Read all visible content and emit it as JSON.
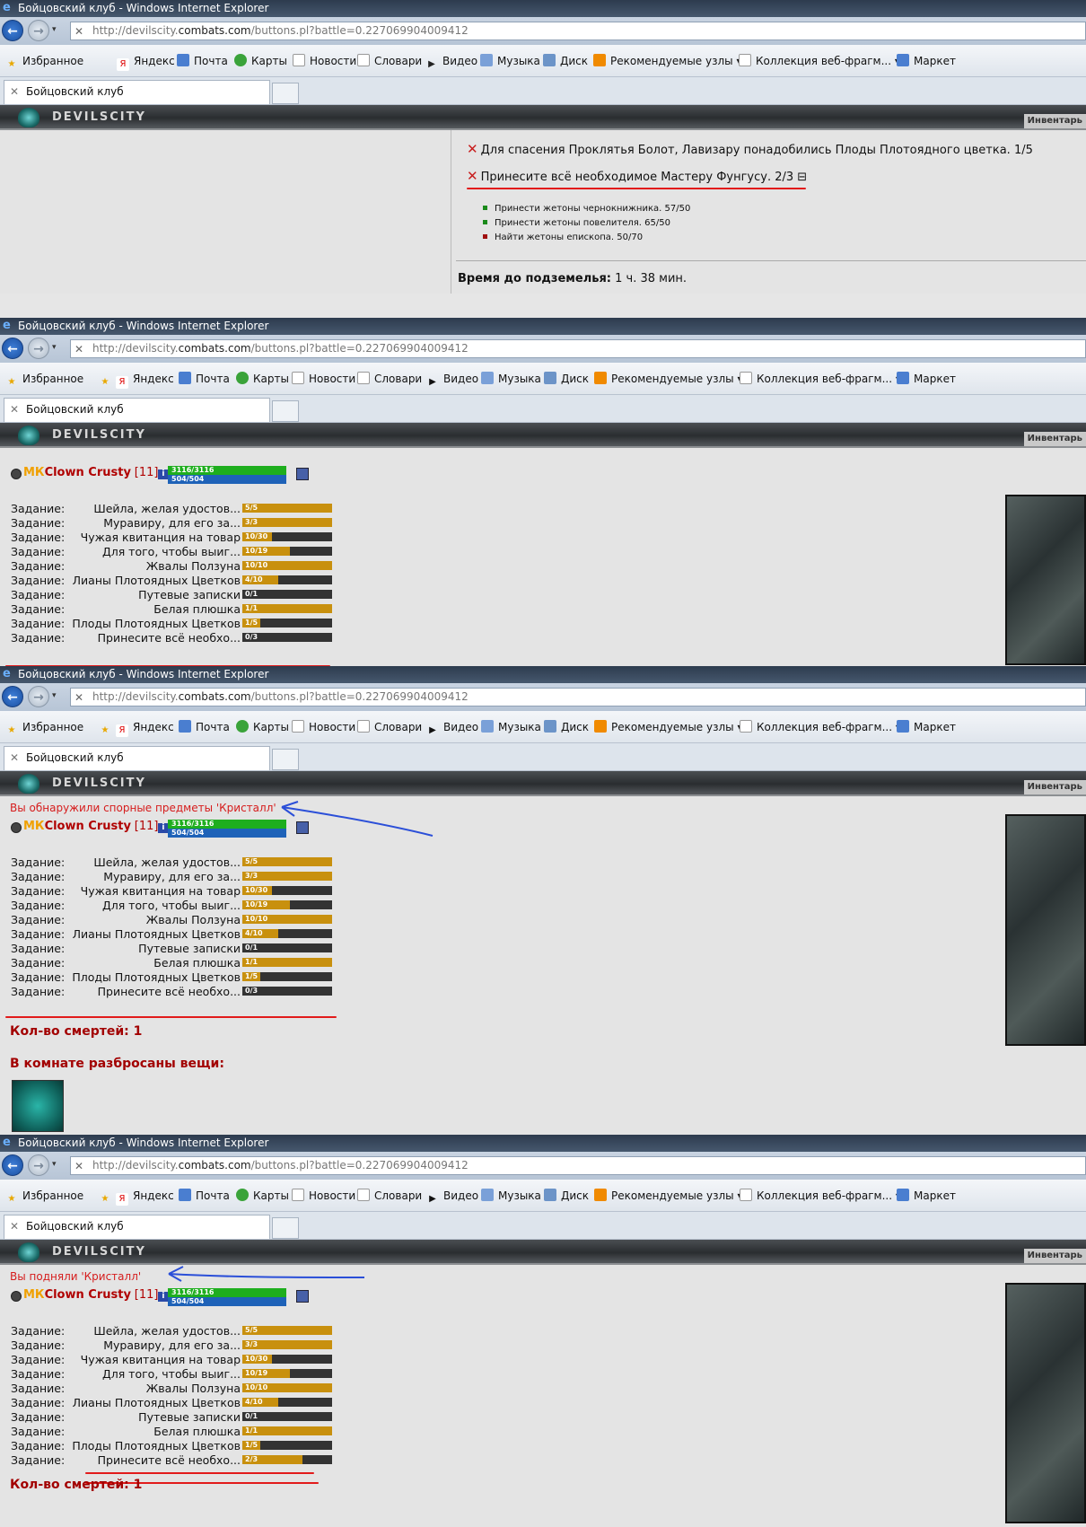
{
  "window_title": "Бойцовский клуб - Windows Internet Explorer",
  "url_prefix": "http://devilscity.",
  "url_host": "combats.com",
  "url_path": "/buttons.pl?battle=0.227069904009412",
  "favorites": {
    "fav": "Избранное",
    "yandex": "Яндекс",
    "mail": "Почта",
    "maps": "Карты",
    "news": "Новости",
    "dict": "Словари",
    "video": "Видео",
    "music": "Музыка",
    "disk": "Диск",
    "recommended": "Рекомендуемые узлы ▾",
    "webslices": "Коллекция веб-фрагм... ▾",
    "market": "Маркет"
  },
  "tab_label": "Бойцовский клуб",
  "game_logo": "DEVILSCITY",
  "inventory_label": "Инвентарь",
  "quest_log": {
    "item1": "Для спасения Проклятья Болот, Лавизару понадобились Плоды Плотоядного цветка. 1/5",
    "item2": "Принесите всё необходимое Мастеру Фунгусу. 2/3 ⊟",
    "sub": [
      {
        "text": "Принести жетоны чернокнижника. 57/50",
        "color": "#1a8a1a"
      },
      {
        "text": "Принести жетоны повелителя. 65/50",
        "color": "#1a8a1a"
      },
      {
        "text": "Найти жетоны епископа. 50/70",
        "color": "#a01010"
      }
    ],
    "timer_label": "Время до подземелья:",
    "timer_value": "1 ч. 38 мин."
  },
  "character": {
    "mk": "МК",
    "name": "Clown Crusty",
    "level": "[11]",
    "info": "i",
    "hp": "3116/3116",
    "mana": "504/504"
  },
  "task_label": "Задание:",
  "tasks": [
    {
      "text": "Шейла, желая удостов...",
      "value": "5/5",
      "fill": 1.0
    },
    {
      "text": "Муравиру, для его за...",
      "value": "3/3",
      "fill": 1.0
    },
    {
      "text": "Чужая квитанция на товар",
      "value": "10/30",
      "fill": 0.33
    },
    {
      "text": "Для того, чтобы выиг...",
      "value": "10/19",
      "fill": 0.53
    },
    {
      "text": "Жвалы Ползуна",
      "value": "10/10",
      "fill": 1.0
    },
    {
      "text": "Лианы Плотоядных Цветков",
      "value": "4/10",
      "fill": 0.4
    },
    {
      "text": "Путевые записки",
      "value": "0/1",
      "fill": 0.0
    },
    {
      "text": "Белая плюшка",
      "value": "1/1",
      "fill": 1.0
    },
    {
      "text": "Плоды Плотоядных Цветков",
      "value": "1/5",
      "fill": 0.2
    },
    {
      "text": "Принесите всё необхо...",
      "value": "0/3",
      "fill": 0.0
    }
  ],
  "task_last_after": {
    "text": "Принесите всё необхо...",
    "value": "2/3",
    "fill": 0.67
  },
  "warn_found": "Вы обнаружили спорные предметы 'Кристалл'",
  "warn_picked": "Вы подняли 'Кристалл'",
  "deaths": "Кол-во смертей: 1",
  "room_items": "В комнате разбросаны вещи:",
  "colors": {
    "annotation_red": "#e21b1b",
    "annotation_blue": "#2b4fd8",
    "game_red": "#a20000"
  }
}
